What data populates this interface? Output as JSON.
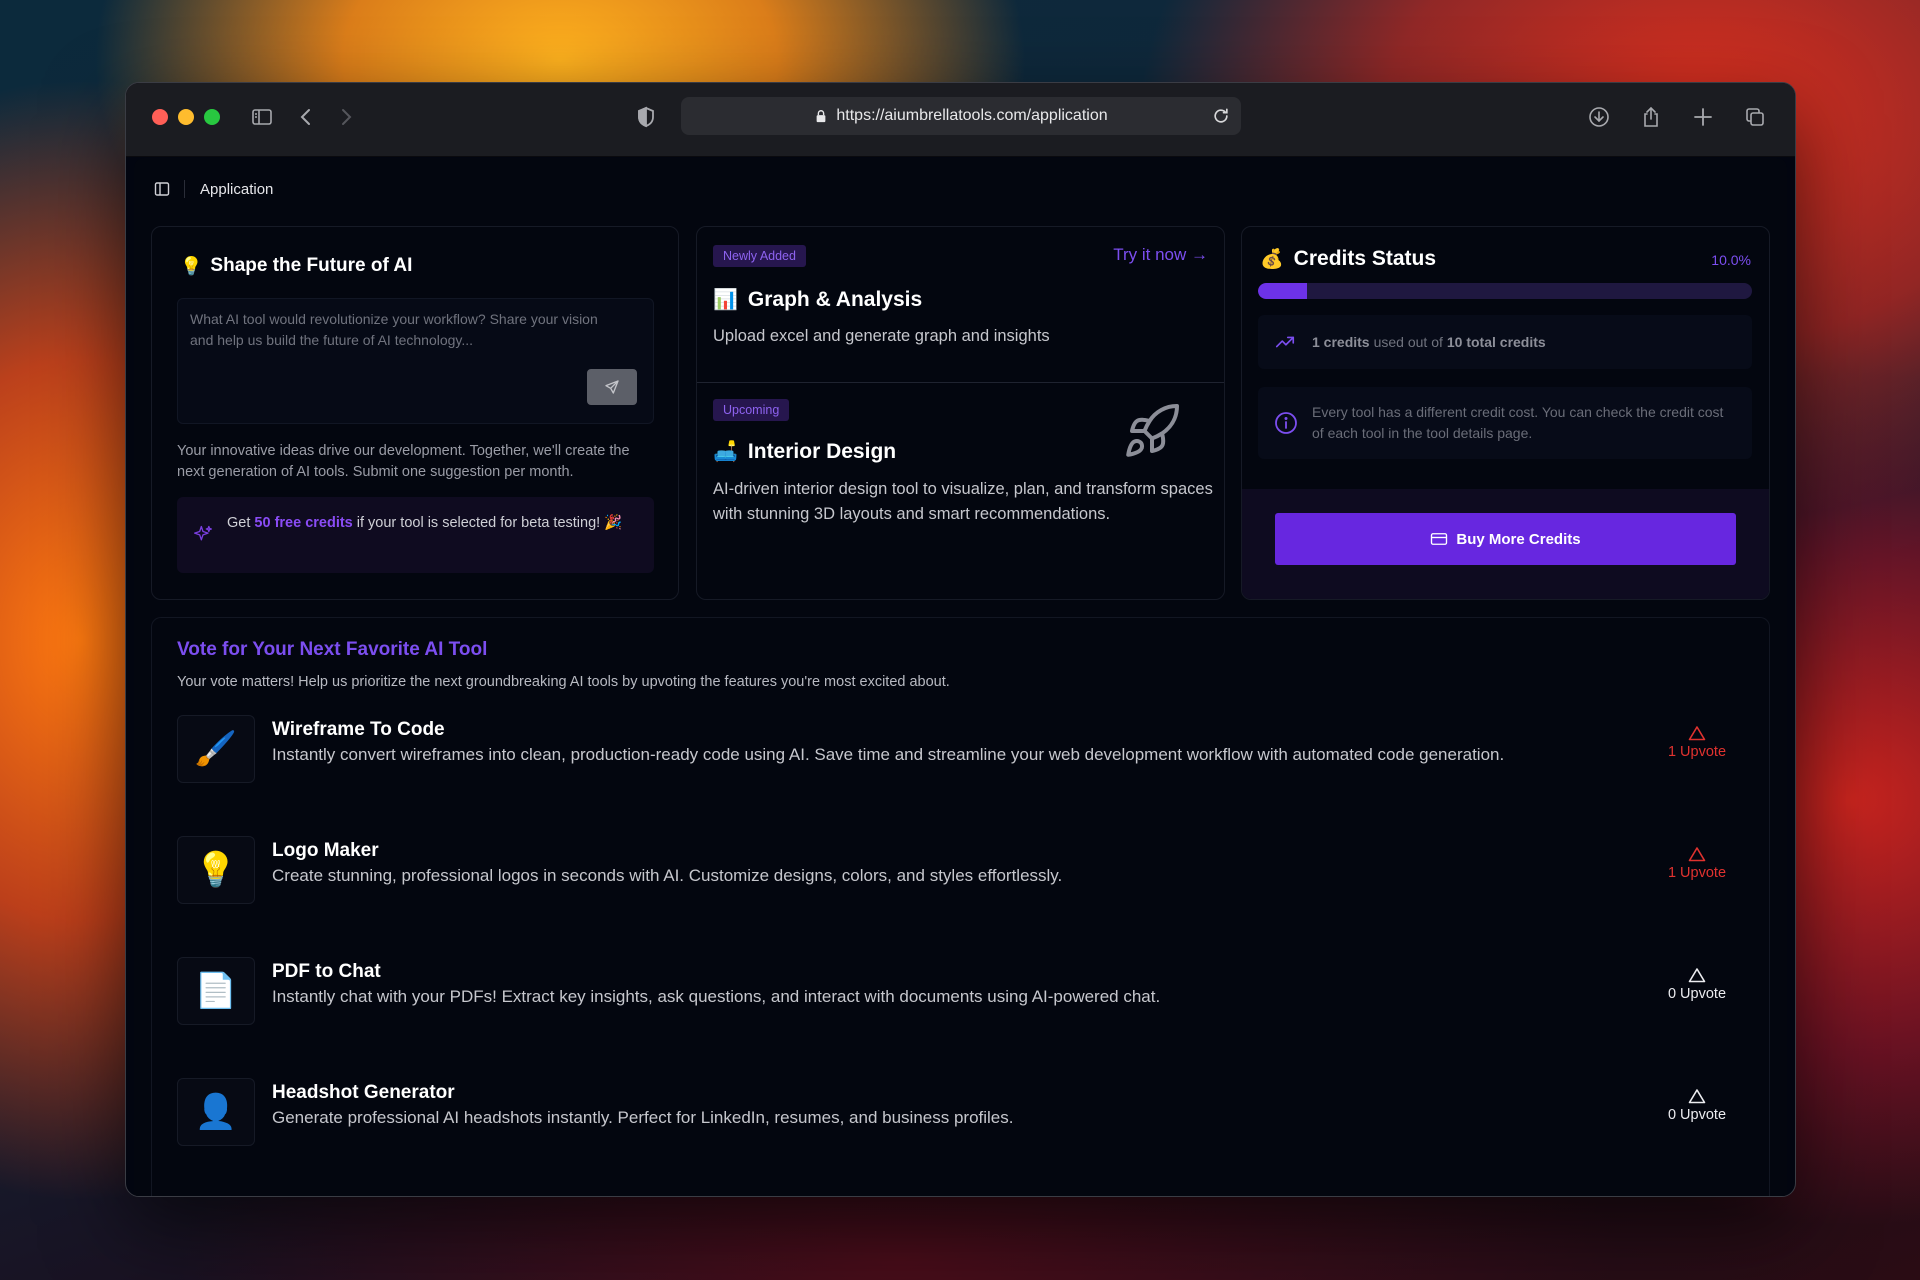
{
  "browser": {
    "url": "https://aiumbrellatools.com/application"
  },
  "breadcrumb": {
    "label": "Application"
  },
  "idea_card": {
    "emoji": "💡",
    "title": "Shape the Future of AI",
    "placeholder": "What AI tool would revolutionize your workflow? Share your vision and help us build the future of AI technology...",
    "description": "Your innovative ideas drive our development. Together, we'll create the next generation of AI tools. Submit one suggestion per month.",
    "promo_prefix": "Get ",
    "promo_highlight": "50 free credits",
    "promo_suffix": " if your tool is selected for beta testing! 🎉"
  },
  "tools_card": {
    "new": {
      "badge": "Newly Added",
      "cta": "Try it now →",
      "emoji": "📊",
      "title": "Graph & Analysis",
      "description": "Upload excel and generate graph and insights"
    },
    "upcoming": {
      "badge": "Upcoming",
      "emoji": "🛋️",
      "title": "Interior Design",
      "description": "AI-driven interior design tool to visualize, plan, and transform spaces with stunning 3D layouts and smart recommendations.",
      "icon": "rocket-icon"
    }
  },
  "credits": {
    "emoji": "💰",
    "title": "Credits Status",
    "percent_label": "10.0%",
    "progress_fraction": 0.1,
    "used_count": "1 credits",
    "used_mid": "used out of",
    "total": "10 total credits",
    "info": "Every tool has a different credit cost. You can check the credit cost of each tool in the tool details page.",
    "buy_label": "Buy More Credits"
  },
  "vote": {
    "title": "Vote for Your Next Favorite AI Tool",
    "subtitle": "Your vote matters! Help us prioritize the next groundbreaking AI tools by upvoting the features you're most excited about.",
    "items": [
      {
        "emoji": "🖌️",
        "name": "Wireframe To Code",
        "description": "Instantly convert wireframes into clean, production-ready code using AI. Save time and streamline your web development workflow with automated code generation.",
        "upvote": "1 Upvote",
        "voted": true
      },
      {
        "emoji": "💡",
        "name": "Logo Maker",
        "description": "Create stunning, professional logos in seconds with AI. Customize designs, colors, and styles effortlessly.",
        "upvote": "1 Upvote",
        "voted": true
      },
      {
        "emoji": "📄",
        "name": "PDF to Chat",
        "description": "Instantly chat with your PDFs! Extract key insights, ask questions, and interact with documents using AI-powered chat.",
        "upvote": "0 Upvote",
        "voted": false
      },
      {
        "emoji": "👤",
        "name": "Headshot Generator",
        "description": "Generate professional AI headshots instantly. Perfect for LinkedIn, resumes, and business profiles.",
        "upvote": "0 Upvote",
        "voted": false
      }
    ]
  },
  "colors": {
    "accent": "#6727e0",
    "accent_text": "#7c4ef0",
    "upvote_active": "#e0322f"
  }
}
